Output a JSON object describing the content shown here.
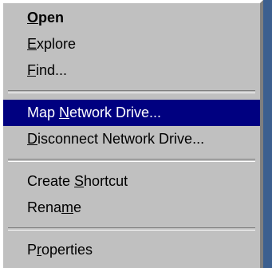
{
  "menu": {
    "items": [
      {
        "pre": "",
        "accel": "O",
        "post": "pen",
        "default": true
      },
      {
        "pre": "",
        "accel": "E",
        "post": "xplore"
      },
      {
        "pre": "",
        "accel": "F",
        "post": "ind..."
      },
      {
        "pre": "Map ",
        "accel": "N",
        "post": "etwork Drive...",
        "highlighted": true
      },
      {
        "pre": "",
        "accel": "D",
        "post": "isconnect Network Drive..."
      },
      {
        "pre": "Create ",
        "accel": "S",
        "post": "hortcut"
      },
      {
        "pre": "Rena",
        "accel": "m",
        "post": "e"
      },
      {
        "pre": "P",
        "accel": "r",
        "post": "operties"
      }
    ]
  }
}
